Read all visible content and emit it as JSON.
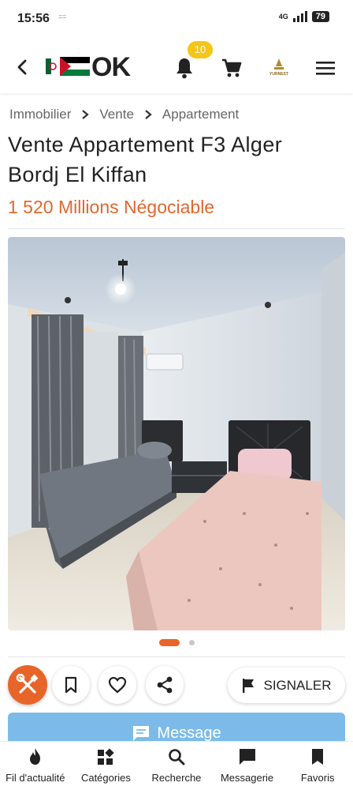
{
  "status_bar": {
    "time": "15:56",
    "indicator": "==",
    "network": "4G",
    "battery": "79"
  },
  "header": {
    "logo_text": "OK",
    "notification_count": "10",
    "brand_mark_text": "YURNEST",
    "icons": [
      "back-arrow-icon",
      "bell-icon",
      "cart-icon",
      "hamburger-menu-icon"
    ]
  },
  "breadcrumb": [
    "Immobilier",
    "Vente",
    "Appartement"
  ],
  "listing": {
    "title": "Vente Appartement F3 Alger Bordj El Kiffan",
    "price": "1 520 Millions Négociable",
    "gallery": {
      "current": 1,
      "total": 2
    }
  },
  "actions": {
    "report_label": "SIGNALER",
    "message_label": "Message",
    "icons": [
      "tools-icon",
      "bookmark-icon",
      "heart-icon",
      "share-icon",
      "flag-icon"
    ]
  },
  "colors": {
    "accent": "#e8652a",
    "message": "#7cbbe9",
    "badge": "#f5c518"
  },
  "bottom_nav": [
    {
      "label": "Fil d'actualité",
      "icon": "flame-icon"
    },
    {
      "label": "Catégories",
      "icon": "categories-icon"
    },
    {
      "label": "Recherche",
      "icon": "search-icon"
    },
    {
      "label": "Messagerie",
      "icon": "chat-icon"
    },
    {
      "label": "Favoris",
      "icon": "bookmark-icon"
    }
  ]
}
